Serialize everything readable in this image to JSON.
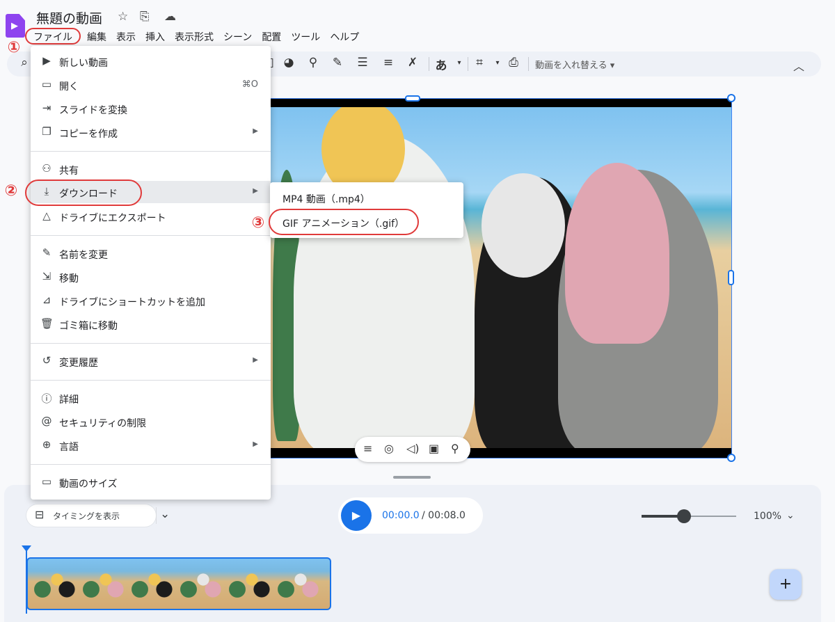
{
  "header": {
    "title": "無題の動画",
    "icons": [
      "star-icon",
      "move-to-folder-icon",
      "cloud-status-icon"
    ]
  },
  "menubar": [
    "ファイル",
    "編集",
    "表示",
    "挿入",
    "表示形式",
    "シーン",
    "配置",
    "ツール",
    "ヘルプ"
  ],
  "toolbar": {
    "replace_video_label": "動画を入れ替える",
    "text_style_glyph": "あ"
  },
  "file_menu": {
    "items": [
      {
        "label": "新しい動画",
        "icon": "new-video-icon"
      },
      {
        "label": "開く",
        "icon": "folder-icon",
        "shortcut": "⌘O"
      },
      {
        "label": "スライドを変換",
        "icon": "import-icon"
      },
      {
        "label": "コピーを作成",
        "icon": "copy-icon",
        "submenu": true
      },
      {
        "label": "共有",
        "icon": "share-person-icon"
      },
      {
        "label": "ダウンロード",
        "icon": "download-icon",
        "submenu": true
      },
      {
        "label": "ドライブにエクスポート",
        "icon": "drive-icon"
      },
      {
        "label": "名前を変更",
        "icon": "pencil-icon"
      },
      {
        "label": "移動",
        "icon": "move-folder-icon"
      },
      {
        "label": "ドライブにショートカットを追加",
        "icon": "drive-shortcut-icon"
      },
      {
        "label": "ゴミ箱に移動",
        "icon": "trash-icon"
      },
      {
        "label": "変更履歴",
        "icon": "history-icon",
        "submenu": true
      },
      {
        "label": "詳細",
        "icon": "info-icon"
      },
      {
        "label": "セキュリティの制限",
        "icon": "security-icon"
      },
      {
        "label": "言語",
        "icon": "globe-icon",
        "submenu": true
      },
      {
        "label": "動画のサイズ",
        "icon": "aspect-ratio-icon"
      }
    ]
  },
  "download_submenu": {
    "items": [
      {
        "label": "MP4 動画（.mp4）"
      },
      {
        "label": "GIF アニメーション（.gif）"
      }
    ]
  },
  "annotations": {
    "step1": "①",
    "step2": "②",
    "step3": "③",
    "color": "#e03a3a"
  },
  "timeline": {
    "timing_label": "タイミングを表示",
    "current_time": "00:00.0",
    "total_time": "/ 00:08.0",
    "zoom": "100%",
    "zoom_slider_fraction": 0.45
  },
  "colors": {
    "accent": "#1a73e8",
    "brand": "#8e44ef",
    "menu_highlight": "#e8eaed"
  }
}
